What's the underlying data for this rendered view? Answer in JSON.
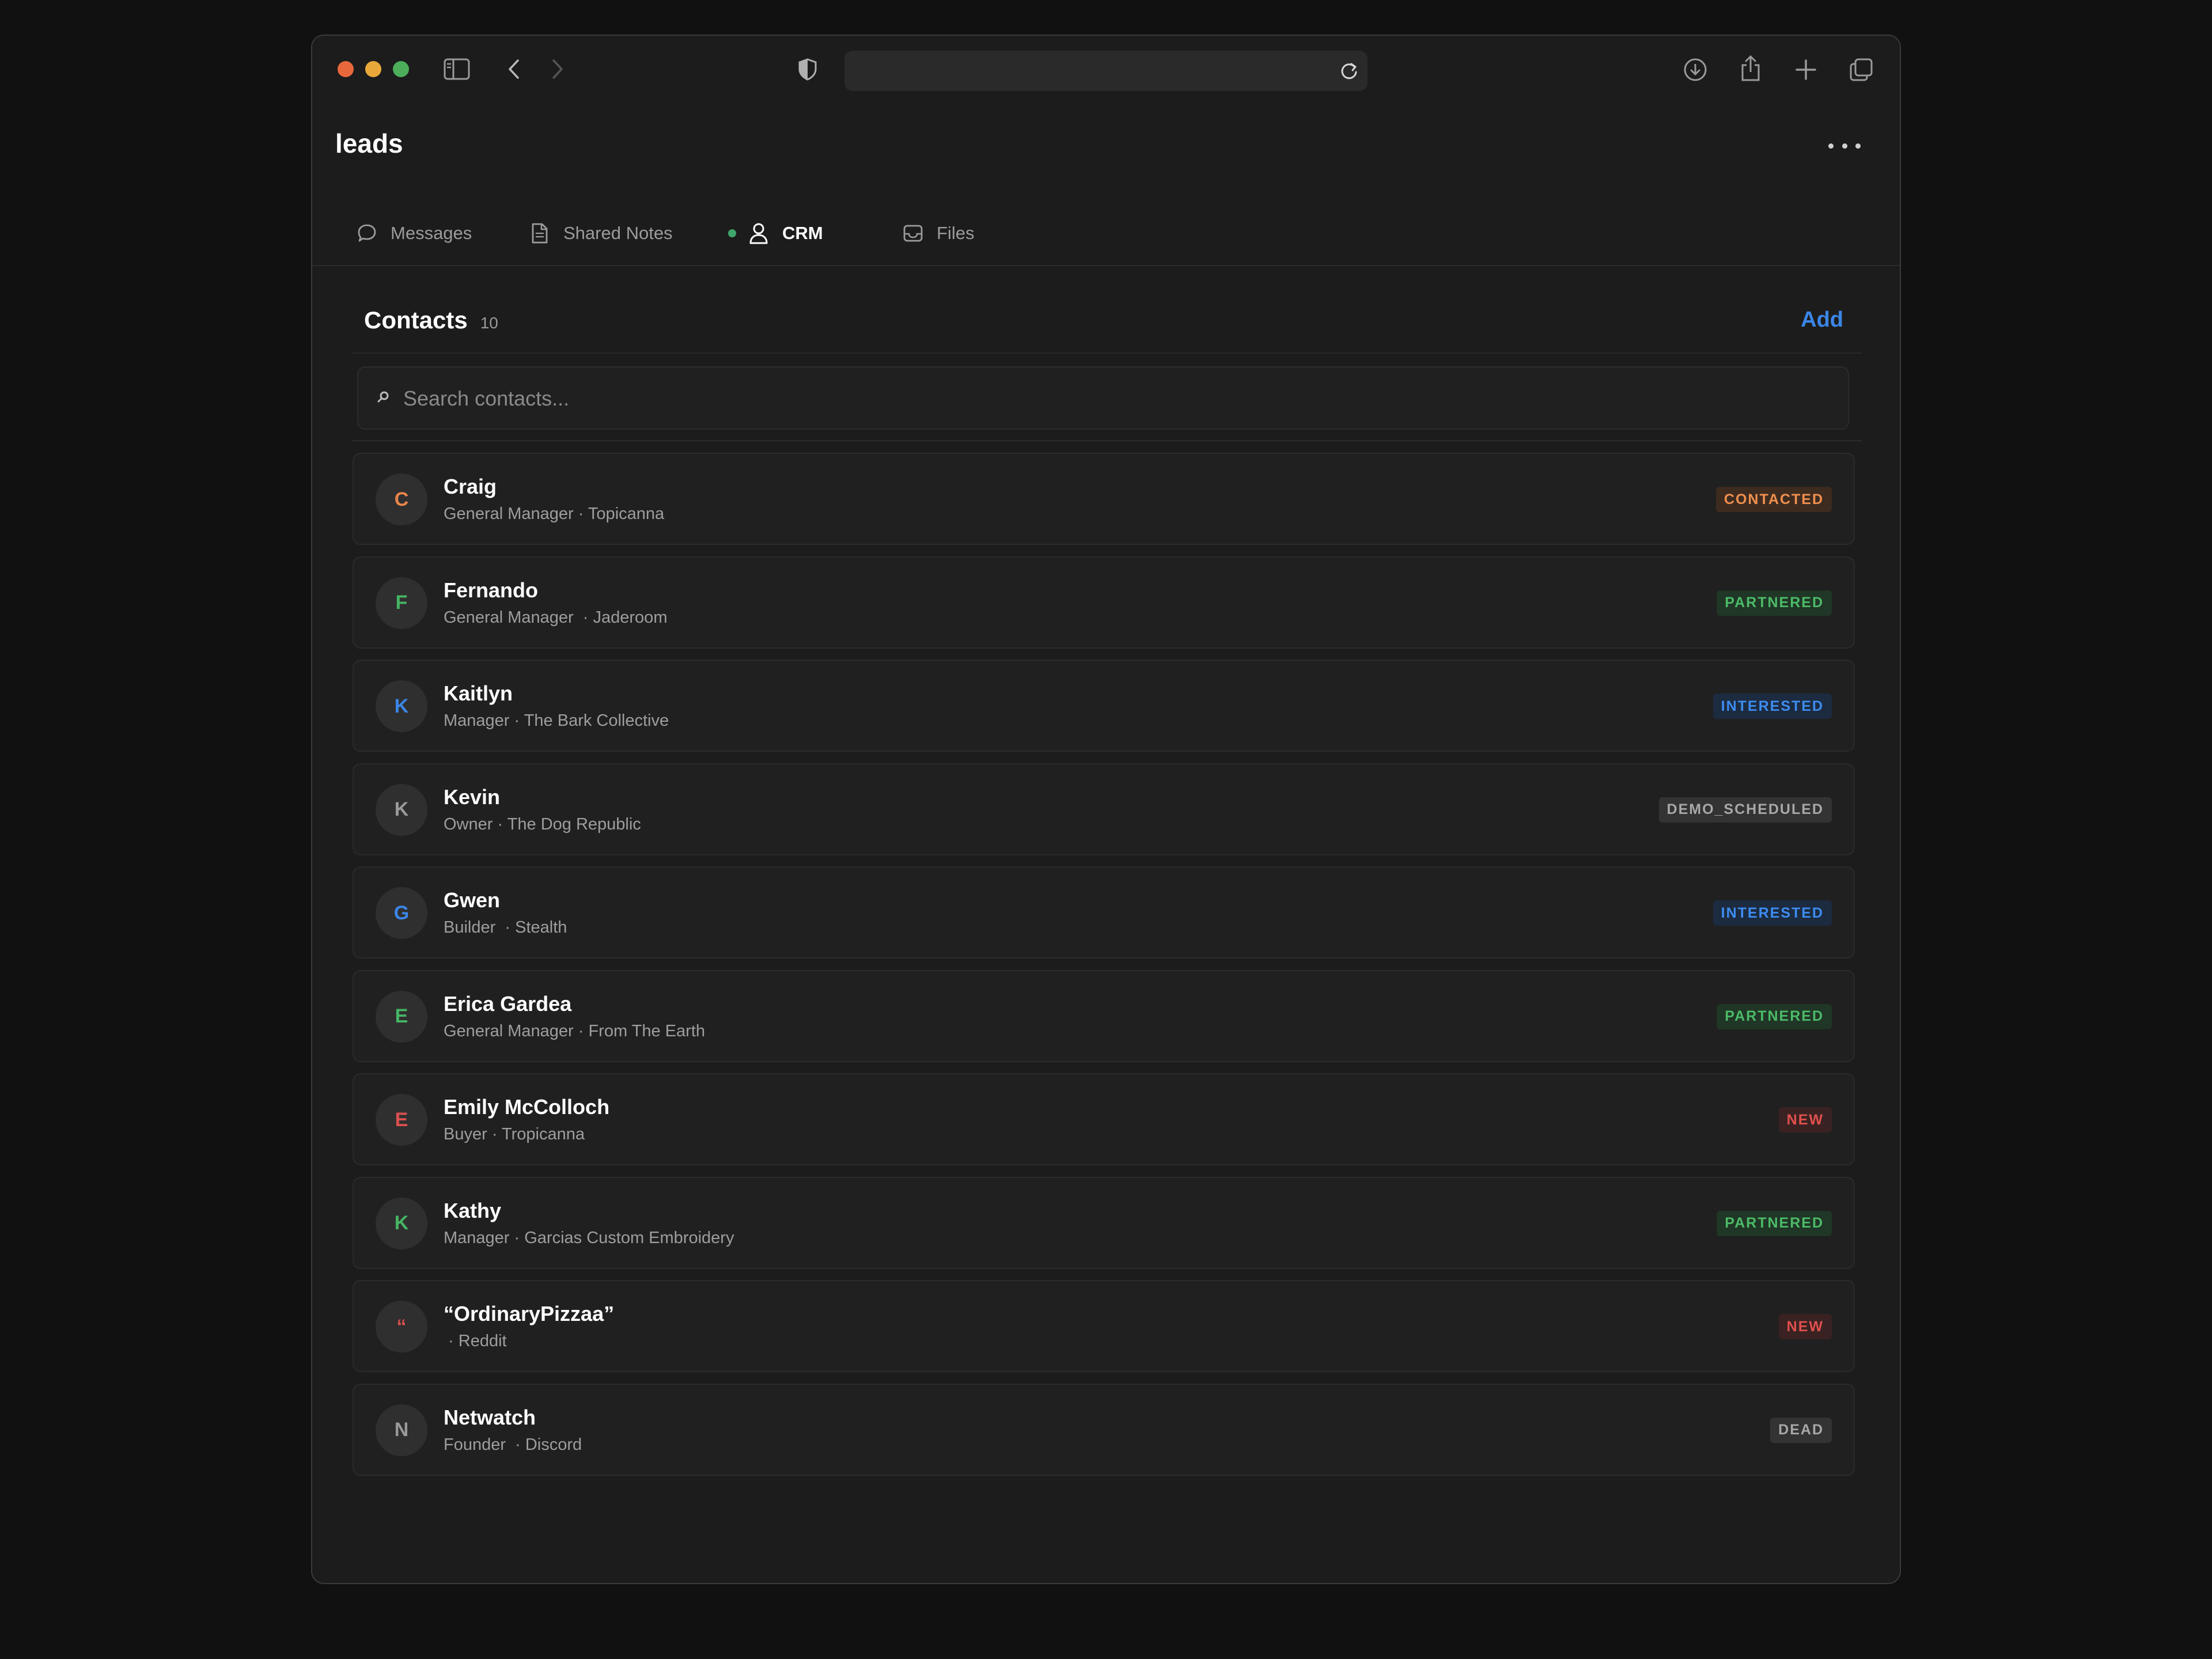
{
  "browser": {
    "url": "",
    "colors": {
      "close": "#e8683c",
      "minimize": "#e9a93a",
      "maximize": "#4cae5a"
    },
    "icons": [
      "sidebar-icon",
      "back-icon",
      "forward-icon",
      "shield-icon",
      "reload-icon",
      "download-icon",
      "share-icon",
      "new-tab-icon",
      "tabs-overview-icon"
    ]
  },
  "page": {
    "title": "leads",
    "more_icon": "ellipsis-icon"
  },
  "tabs": [
    {
      "label": "Messages",
      "icon": "chat-bubble-icon",
      "active": false
    },
    {
      "label": "Shared Notes",
      "icon": "document-icon",
      "active": false
    },
    {
      "label": "CRM",
      "icon": "person-icon",
      "active": true
    },
    {
      "label": "Files",
      "icon": "inbox-icon",
      "active": false
    }
  ],
  "contacts": {
    "title": "Contacts",
    "count": "10",
    "add_label": "Add",
    "search_placeholder": "Search contacts...",
    "search_value": "",
    "rows": [
      {
        "initial": "C",
        "name": "Craig",
        "subtitle": "General Manager · Topicanna",
        "status": "CONTACTED",
        "avatar_color": "#e8844a",
        "badge_fg": "#f0904e",
        "badge_bg": "#3d2b20"
      },
      {
        "initial": "F",
        "name": "Fernando",
        "subtitle": "General Manager  · Jaderoom",
        "status": "PARTNERED",
        "avatar_color": "#46b564",
        "badge_fg": "#4cbb68",
        "badge_bg": "#203626"
      },
      {
        "initial": "K",
        "name": "Kaitlyn",
        "subtitle": "Manager · The Bark Collective",
        "status": "INTERESTED",
        "avatar_color": "#3b86e8",
        "badge_fg": "#3d8cf0",
        "badge_bg": "#1c2b40"
      },
      {
        "initial": "K",
        "name": "Kevin",
        "subtitle": "Owner · The Dog Republic",
        "status": "DEMO_SCHEDULED",
        "avatar_color": "#9a9a9a",
        "badge_fg": "#a8a8a8",
        "badge_bg": "#333333"
      },
      {
        "initial": "G",
        "name": "Gwen",
        "subtitle": "Builder  · Stealth",
        "status": "INTERESTED",
        "avatar_color": "#3b86e8",
        "badge_fg": "#3d8cf0",
        "badge_bg": "#1c2b40"
      },
      {
        "initial": "E",
        "name": "Erica Gardea",
        "subtitle": "General Manager · From The Earth",
        "status": "PARTNERED",
        "avatar_color": "#46b564",
        "badge_fg": "#4cbb68",
        "badge_bg": "#203626"
      },
      {
        "initial": "E",
        "name": "Emily McColloch",
        "subtitle": "Buyer · Tropicanna",
        "status": "NEW",
        "avatar_color": "#d9504f",
        "badge_fg": "#e0504e",
        "badge_bg": "#3a2222"
      },
      {
        "initial": "K",
        "name": "Kathy",
        "subtitle": "Manager · Garcias Custom Embroidery",
        "status": "PARTNERED",
        "avatar_color": "#46b564",
        "badge_fg": "#4cbb68",
        "badge_bg": "#203626"
      },
      {
        "initial": "“",
        "name": "“OrdinaryPizzaa”",
        "subtitle": " · Reddit",
        "status": "NEW",
        "avatar_color": "#d9504f",
        "badge_fg": "#e0504e",
        "badge_bg": "#3a2222"
      },
      {
        "initial": "N",
        "name": "Netwatch",
        "subtitle": "Founder  · Discord",
        "status": "DEAD",
        "avatar_color": "#9a9a9a",
        "badge_fg": "#a8a8a8",
        "badge_bg": "#333333"
      }
    ]
  }
}
